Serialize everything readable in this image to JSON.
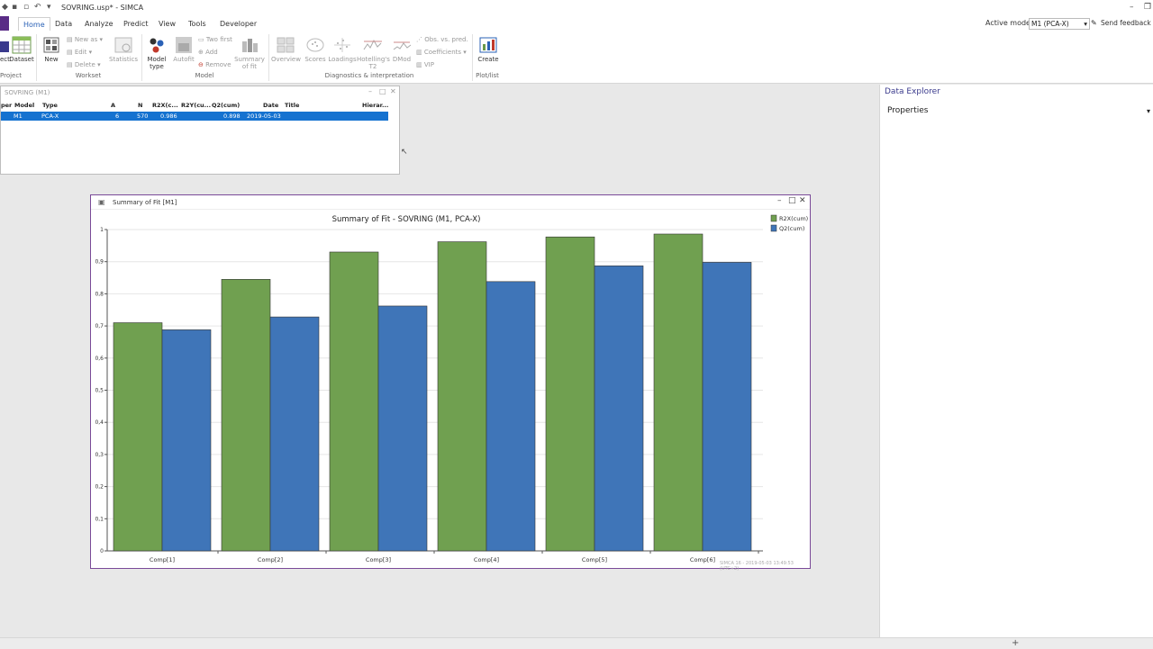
{
  "window": {
    "title": "SOVRING.usp* - SIMCA"
  },
  "tabs": [
    "Home",
    "Data",
    "Analyze",
    "Predict",
    "View",
    "Tools",
    "Developer"
  ],
  "active_tab": "Home",
  "active_model": {
    "label": "Active model:",
    "value": "M1 (PCA-X)"
  },
  "feedback": "Send feedback",
  "ribbon": {
    "project": {
      "group": "Project",
      "buttons": [
        "ect",
        "Dataset"
      ]
    },
    "workset": {
      "group": "Workset",
      "new": "New",
      "new_as": "New as",
      "edit": "Edit",
      "delete": "Delete",
      "statistics": "Statistics"
    },
    "model": {
      "group": "Model",
      "model_type": "Model type",
      "autofit": "Autofit",
      "two_first": "Two first",
      "add": "Add",
      "remove": "Remove",
      "summary": "Summary of fit"
    },
    "diagnostics": {
      "group": "Diagnostics & interpretation",
      "overview": "Overview",
      "scores": "Scores",
      "loadings": "Loadings",
      "hotelling": "Hotelling's T2",
      "dmod": "DMod",
      "obs_vs_pred": "Obs. vs. pred.",
      "coefficients": "Coefficients",
      "vip": "VIP"
    },
    "plotlist": {
      "group": "Plot/list",
      "create": "Create"
    }
  },
  "workset_window": {
    "title": "SOVRING (M1)",
    "headers": [
      "per",
      "Model",
      "Type",
      "A",
      "N",
      "R2X(c...",
      "R2Y(cu...",
      "Q2(cum)",
      "Date",
      "Title",
      "Hierar..."
    ],
    "row": {
      "model": "M1",
      "type": "PCA-X",
      "a": "6",
      "n": "570",
      "r2x": "0.986",
      "q2": "0.898",
      "date": "2019-05-03"
    }
  },
  "chart_window": {
    "title": "Summary of Fit [M1]",
    "footer": "SIMCA 16 - 2019-05-03 13:49:53 (UTC+2)"
  },
  "chart_data": {
    "type": "bar",
    "title": "Summary of Fit - SOVRING (M1, PCA-X)",
    "categories": [
      "Comp[1]",
      "Comp[2]",
      "Comp[3]",
      "Comp[4]",
      "Comp[5]",
      "Comp[6]"
    ],
    "series": [
      {
        "name": "R2X(cum)",
        "color": "#70a050",
        "values": [
          0.71,
          0.845,
          0.93,
          0.962,
          0.977,
          0.986
        ]
      },
      {
        "name": "Q2(cum)",
        "color": "#3f75b8",
        "values": [
          0.688,
          0.728,
          0.762,
          0.838,
          0.887,
          0.898
        ]
      }
    ],
    "ylim": [
      0,
      1
    ],
    "yticks": [
      "0",
      "0,1",
      "0,2",
      "0,3",
      "0,4",
      "0,5",
      "0,6",
      "0,7",
      "0,8",
      "0,9",
      "1"
    ],
    "legend": "top-right",
    "grid": true
  },
  "explorer": {
    "title": "Data Explorer",
    "properties": "Properties"
  }
}
